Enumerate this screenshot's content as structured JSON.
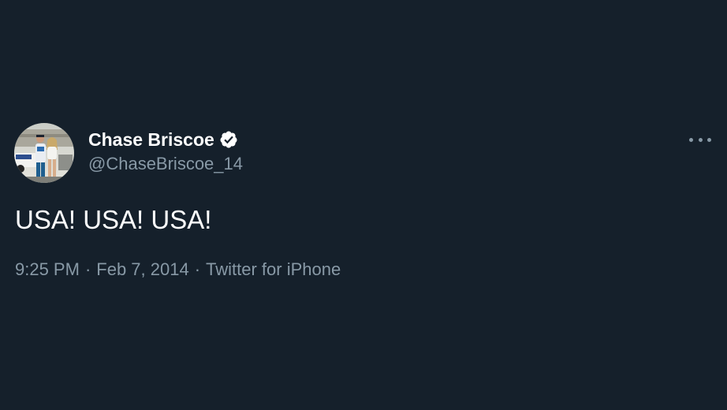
{
  "tweet": {
    "author": {
      "display_name": "Chase Briscoe",
      "handle": "@ChaseBriscoe_14",
      "verified": true,
      "avatar": "avatar-photo"
    },
    "text": "USA! USA! USA!",
    "meta": {
      "time": "9:25 PM",
      "date": "Feb 7, 2014",
      "separator": "·",
      "source": "Twitter for iPhone"
    },
    "menu_icon": "more-horizontal-icon"
  },
  "colors": {
    "background": "#15202b",
    "primary_text": "#ffffff",
    "secondary_text": "#8899a6",
    "verified_badge": "#ffffff"
  }
}
